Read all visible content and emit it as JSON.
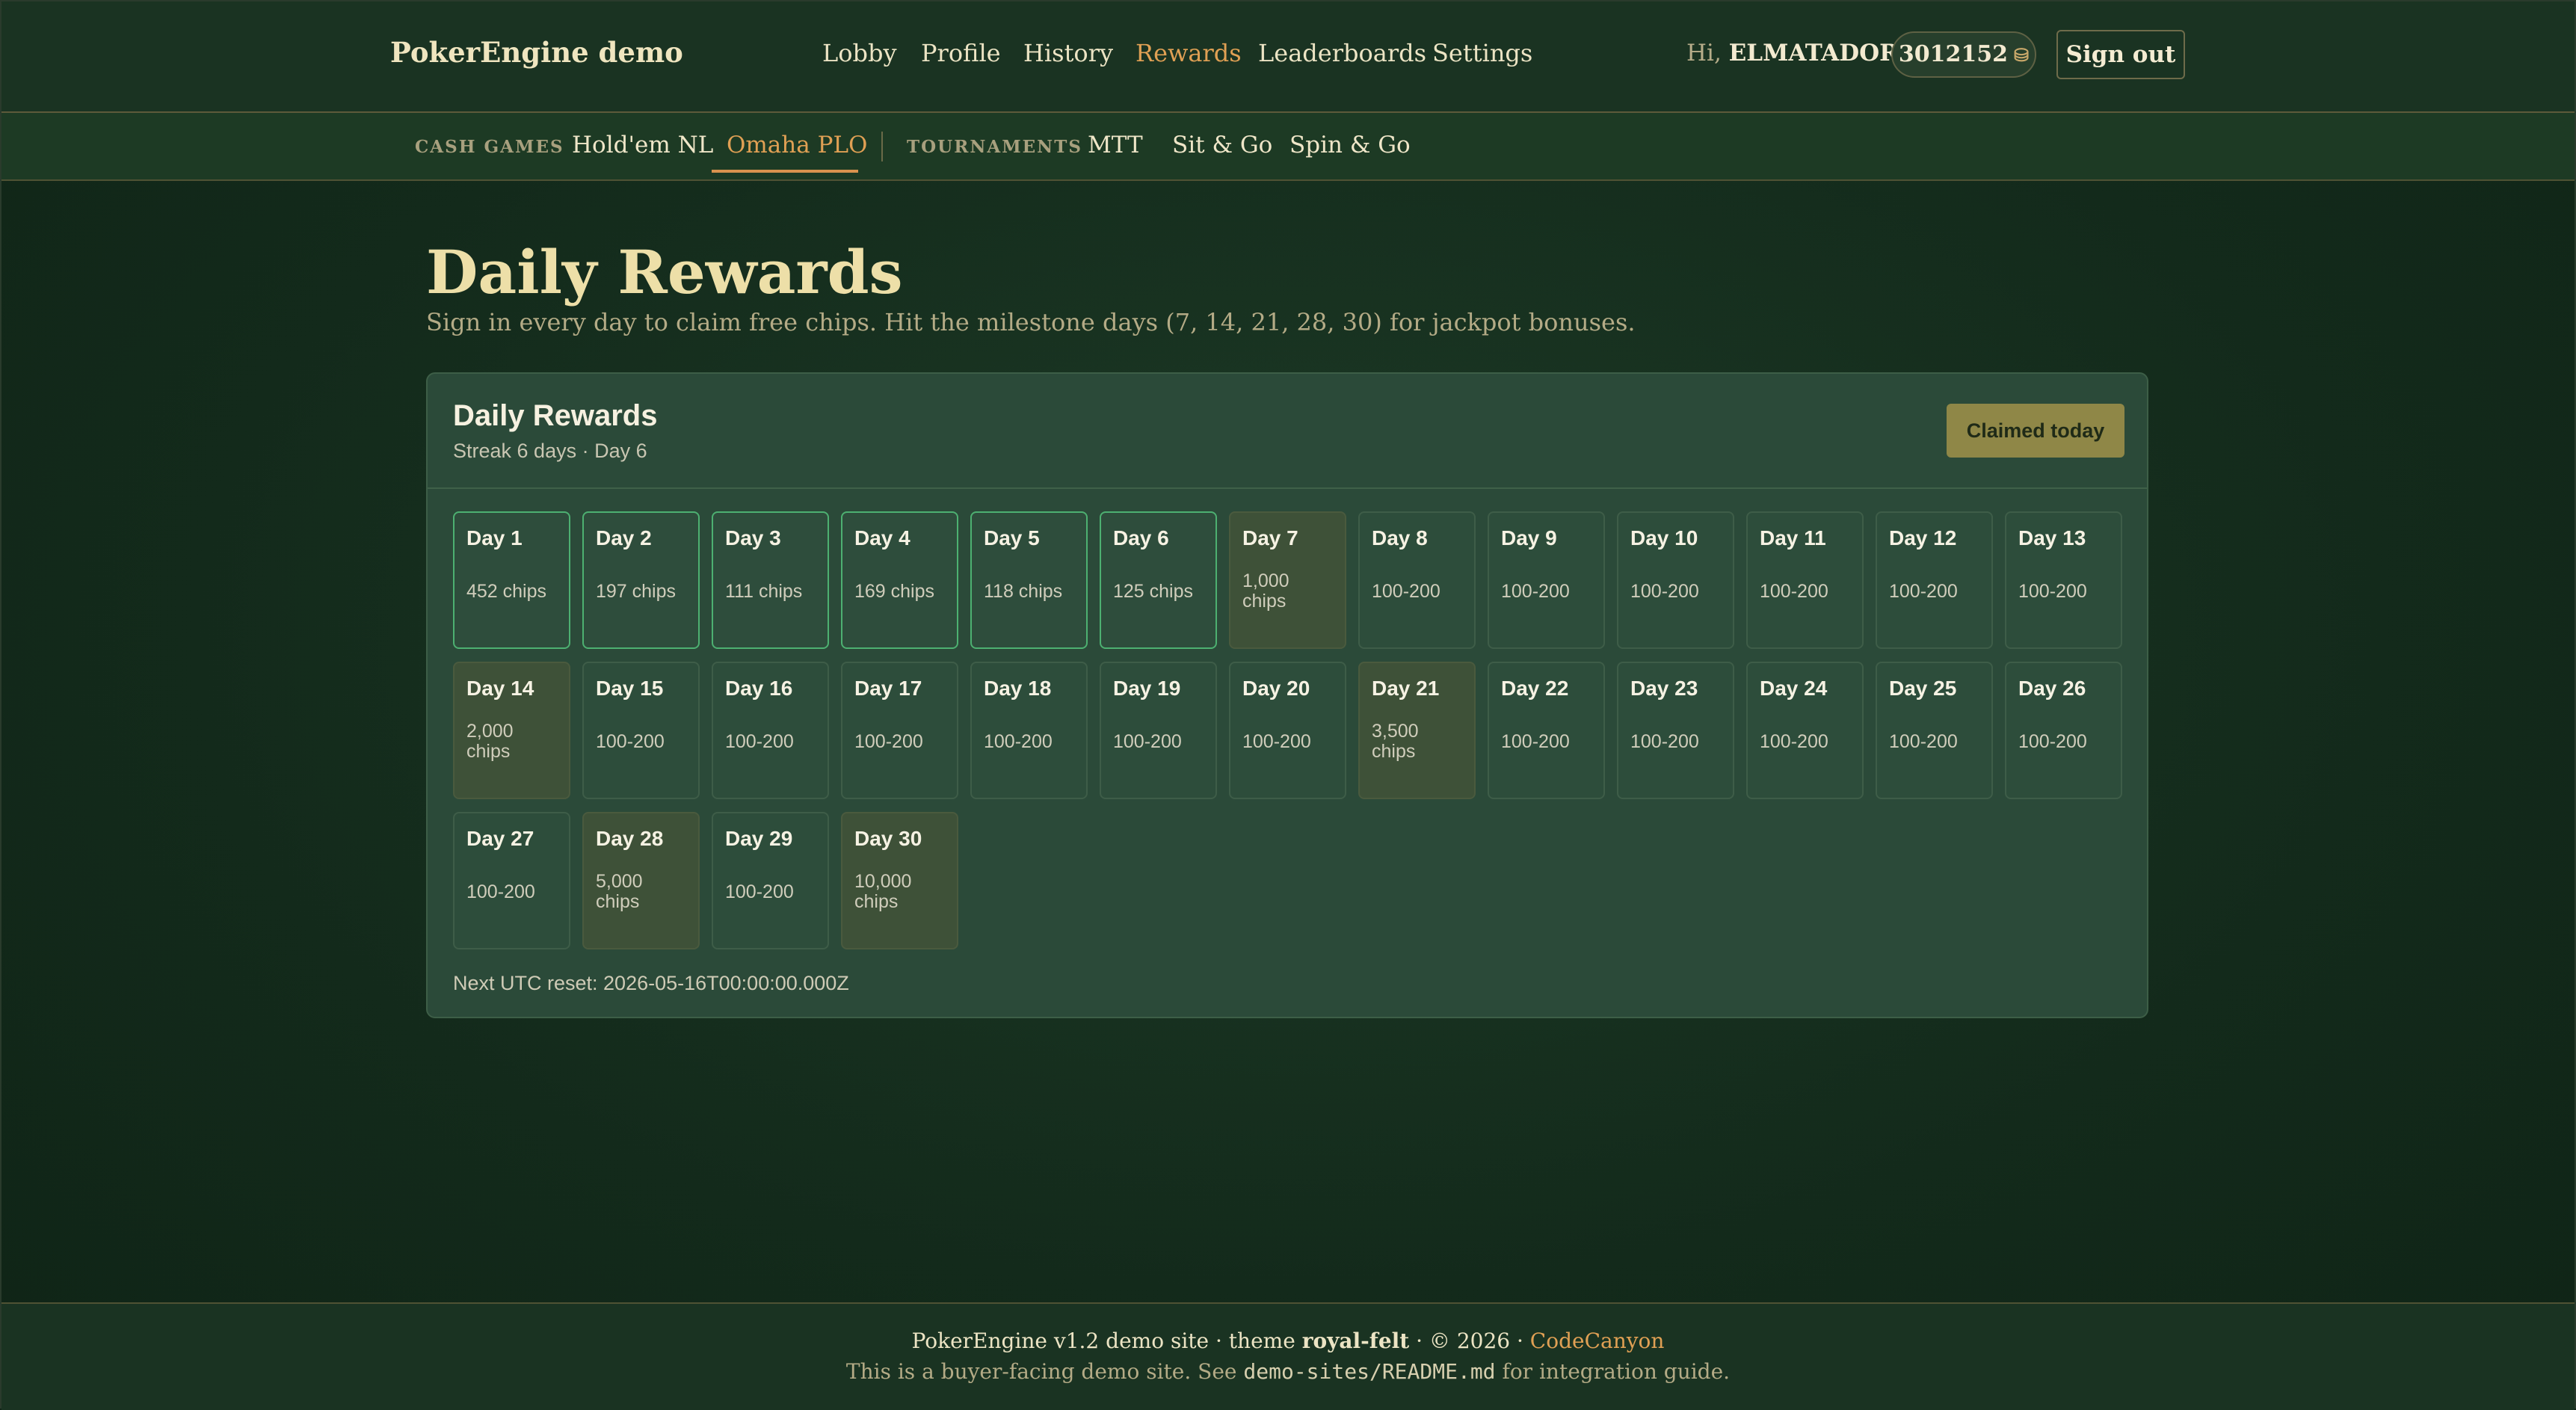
{
  "header": {
    "brand": "PokerEngine demo",
    "nav": [
      "Lobby",
      "Profile",
      "History",
      "Rewards",
      "Leaderboards",
      "Settings"
    ],
    "active_nav": "Rewards",
    "greeting_prefix": "Hi,",
    "username": "ELMATADOR",
    "balance": "3012152",
    "sign_out": "Sign out"
  },
  "subnav": {
    "cash_label": "CASH GAMES",
    "cash_items": [
      "Hold'em NL",
      "Omaha PLO"
    ],
    "active": "Omaha PLO",
    "tournament_label": "TOURNAMENTS",
    "tournament_items": [
      "MTT",
      "Sit & Go",
      "Spin & Go"
    ]
  },
  "page": {
    "title": "Daily Rewards",
    "subtitle": "Sign in every day to claim free chips. Hit the milestone days (7, 14, 21, 28, 30) for jackpot bonuses."
  },
  "card": {
    "title": "Daily Rewards",
    "meta": "Streak 6 days · Day 6",
    "button": "Claimed today",
    "reset": "Next UTC reset: 2026-05-16T00:00:00.000Z"
  },
  "days": [
    {
      "label": "Day 1",
      "value": "452 chips",
      "state": "claimed"
    },
    {
      "label": "Day 2",
      "value": "197 chips",
      "state": "claimed"
    },
    {
      "label": "Day 3",
      "value": "111 chips",
      "state": "claimed"
    },
    {
      "label": "Day 4",
      "value": "169 chips",
      "state": "claimed"
    },
    {
      "label": "Day 5",
      "value": "118 chips",
      "state": "claimed"
    },
    {
      "label": "Day 6",
      "value": "125 chips",
      "state": "claimed"
    },
    {
      "label": "Day 7",
      "value": "1,000 chips",
      "state": "milestone"
    },
    {
      "label": "Day 8",
      "value": "100-200",
      "state": "upcoming"
    },
    {
      "label": "Day 9",
      "value": "100-200",
      "state": "upcoming"
    },
    {
      "label": "Day 10",
      "value": "100-200",
      "state": "upcoming"
    },
    {
      "label": "Day 11",
      "value": "100-200",
      "state": "upcoming"
    },
    {
      "label": "Day 12",
      "value": "100-200",
      "state": "upcoming"
    },
    {
      "label": "Day 13",
      "value": "100-200",
      "state": "upcoming"
    },
    {
      "label": "Day 14",
      "value": "2,000 chips",
      "state": "milestone"
    },
    {
      "label": "Day 15",
      "value": "100-200",
      "state": "upcoming"
    },
    {
      "label": "Day 16",
      "value": "100-200",
      "state": "upcoming"
    },
    {
      "label": "Day 17",
      "value": "100-200",
      "state": "upcoming"
    },
    {
      "label": "Day 18",
      "value": "100-200",
      "state": "upcoming"
    },
    {
      "label": "Day 19",
      "value": "100-200",
      "state": "upcoming"
    },
    {
      "label": "Day 20",
      "value": "100-200",
      "state": "upcoming"
    },
    {
      "label": "Day 21",
      "value": "3,500 chips",
      "state": "milestone"
    },
    {
      "label": "Day 22",
      "value": "100-200",
      "state": "upcoming"
    },
    {
      "label": "Day 23",
      "value": "100-200",
      "state": "upcoming"
    },
    {
      "label": "Day 24",
      "value": "100-200",
      "state": "upcoming"
    },
    {
      "label": "Day 25",
      "value": "100-200",
      "state": "upcoming"
    },
    {
      "label": "Day 26",
      "value": "100-200",
      "state": "upcoming"
    },
    {
      "label": "Day 27",
      "value": "100-200",
      "state": "upcoming"
    },
    {
      "label": "Day 28",
      "value": "5,000 chips",
      "state": "milestone"
    },
    {
      "label": "Day 29",
      "value": "100-200",
      "state": "upcoming"
    },
    {
      "label": "Day 30",
      "value": "10,000 chips",
      "state": "milestone"
    }
  ],
  "footer": {
    "line1_prefix": "PokerEngine v1.2 demo site · theme",
    "theme": "royal-felt",
    "line1_suffix": "· © 2026 ·",
    "link": "CodeCanyon",
    "line2_prefix": "This is a buyer-facing demo site. See",
    "readme": "demo-sites/README.md",
    "line2_suffix": "for integration guide."
  },
  "colors": {
    "accent": "#e0a054",
    "claimed_border": "#4db071",
    "milestone_bg": "#3e5138",
    "button_bg": "#8f8747"
  },
  "icons": {
    "balance": "chip-stack-icon"
  }
}
